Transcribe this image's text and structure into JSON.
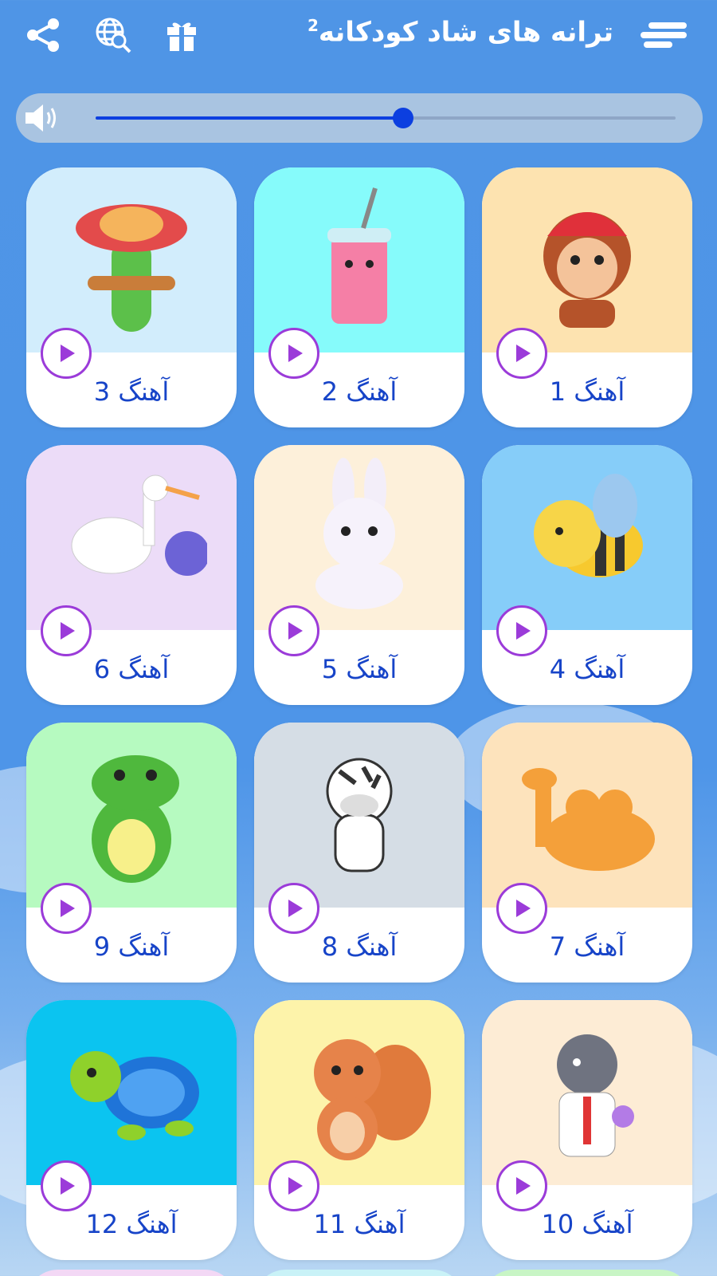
{
  "header": {
    "title": "ترانه های شاد کودکانه",
    "title_superscript": "2",
    "icons": [
      "menu-icon",
      "gift-icon",
      "web-search-icon",
      "share-icon"
    ]
  },
  "volume": {
    "level": 0.53,
    "icon": "speaker-icon"
  },
  "songs": [
    {
      "label": "آهنگ 1",
      "bg": "#fde3b0",
      "character": "monkey"
    },
    {
      "label": "آهنگ 2",
      "bg": "#86fbfb",
      "character": "smoothie"
    },
    {
      "label": "آهنگ 3",
      "bg": "#d2edfc",
      "character": "cactus"
    },
    {
      "label": "آهنگ 4",
      "bg": "#86cdf9",
      "character": "bee"
    },
    {
      "label": "آهنگ 5",
      "bg": "#fdf0da",
      "character": "bunny"
    },
    {
      "label": "آهنگ 6",
      "bg": "#ecdcf8",
      "character": "stork"
    },
    {
      "label": "آهنگ 7",
      "bg": "#fde3bc",
      "character": "camel"
    },
    {
      "label": "آهنگ 8",
      "bg": "#d5dde5",
      "character": "zebra"
    },
    {
      "label": "آهنگ 9",
      "bg": "#b6fac0",
      "character": "dinosaur"
    },
    {
      "label": "آهنگ 10",
      "bg": "#fdecd5",
      "character": "zebra-scientist"
    },
    {
      "label": "آهنگ 11",
      "bg": "#fdf3aa",
      "character": "squirrel"
    },
    {
      "label": "آهنگ 12",
      "bg": "#0bc4f0",
      "character": "turtle"
    }
  ],
  "colors": {
    "accent": "#0c3fe0",
    "play_ring": "#9b3bd9",
    "label_text": "#1744c8"
  }
}
